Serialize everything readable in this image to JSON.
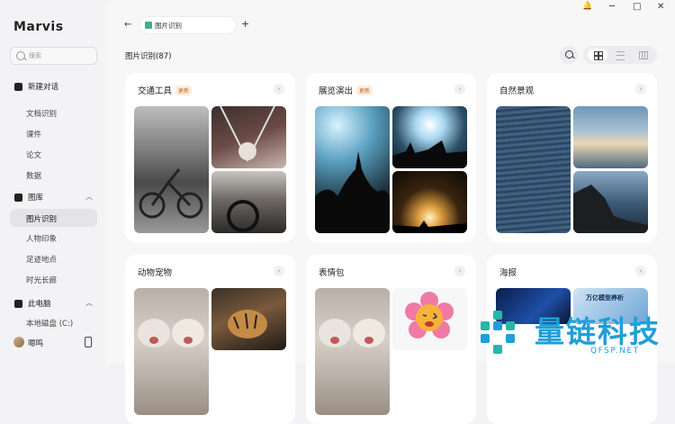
{
  "app": {
    "title": "Marvis"
  },
  "search": {
    "placeholder": "搜索"
  },
  "nav": {
    "new_chat": "新建对话",
    "docs": "文档识别",
    "courseware": "课件",
    "papers": "论文",
    "data": "数据",
    "gallery": "图库",
    "image_recognition": "图片识别",
    "people": "人物印象",
    "places": "足迹地点",
    "timeline": "时光长廊",
    "this_pc": "此电脑",
    "local_disk": "本地磁盘 (C:)",
    "user": "嗯鸣"
  },
  "tabs": {
    "active_tab": "图片识别",
    "back": "←",
    "add": "+"
  },
  "window": {
    "bell": "🔔",
    "minimize": "─",
    "maximize": "□",
    "close": "✕"
  },
  "content": {
    "section_title": "图片识别(87)"
  },
  "cards": [
    {
      "title": "交通工具",
      "badge": "更新"
    },
    {
      "title": "展览演出",
      "badge": "更新"
    },
    {
      "title": "自然景观",
      "badge": ""
    },
    {
      "title": "动物宠物",
      "badge": ""
    },
    {
      "title": "表情包",
      "badge": ""
    },
    {
      "title": "海报",
      "badge": ""
    }
  ],
  "poster_text": {
    "line1": "万亿模型养析"
  },
  "watermark": {
    "text": "量链科技",
    "sub": "QFSP.NET"
  },
  "colors": {
    "accent": "#1f9fd8",
    "badge": "#c26a20",
    "tab_icon": "#3db08a"
  }
}
